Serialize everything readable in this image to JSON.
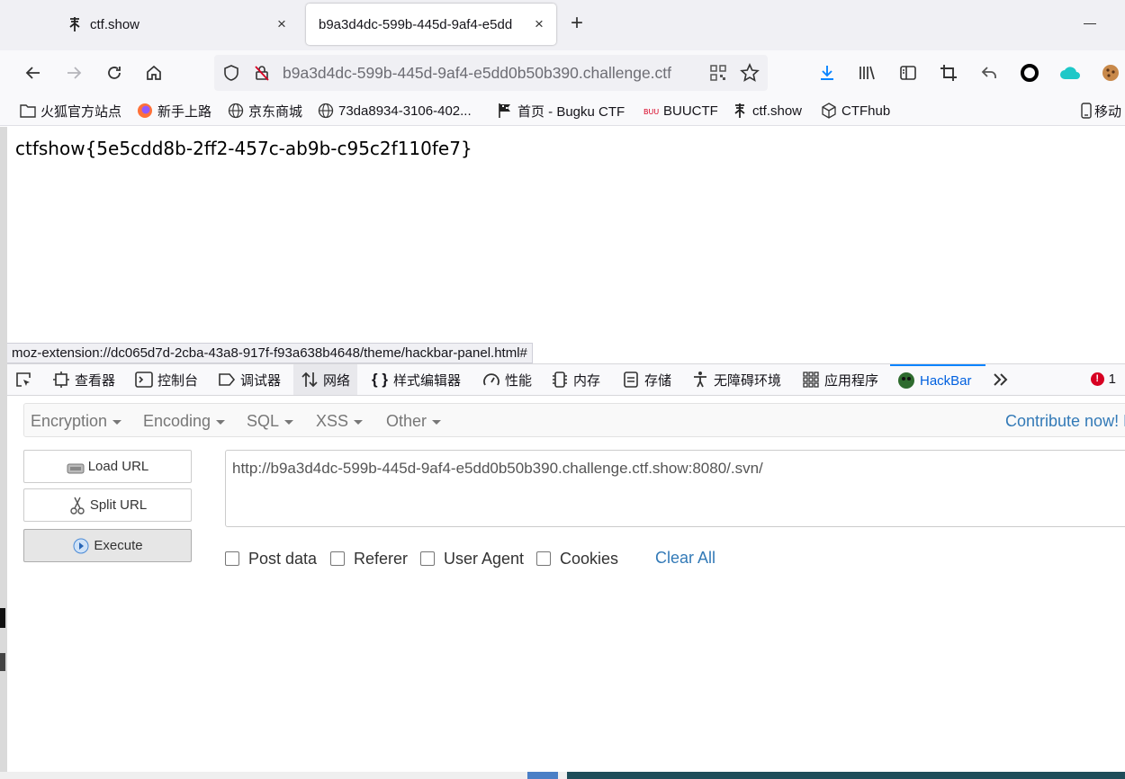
{
  "tabs": [
    {
      "title": "ctf.show",
      "close": "×"
    },
    {
      "title": "b9a3d4dc-599b-445d-9af4-e5dd",
      "close": "×"
    }
  ],
  "new_tab": "+",
  "navbar": {
    "url": "b9a3d4dc-599b-445d-9af4-e5dd0b50b390.challenge.ctf"
  },
  "bookmarks": [
    {
      "label": "火狐官方站点",
      "icon": "folder-icon"
    },
    {
      "label": "新手上路",
      "icon": "firefox-icon"
    },
    {
      "label": "京东商城",
      "icon": "globe-icon"
    },
    {
      "label": "73da8934-3106-402...",
      "icon": "globe-icon"
    },
    {
      "label": "首页 - Bugku CTF",
      "icon": "flag-icon"
    },
    {
      "label": "BUUCTF",
      "icon": "buuctf-icon"
    },
    {
      "label": "ctf.show",
      "icon": "ctfshow-icon"
    },
    {
      "label": "CTFhub",
      "icon": "cube-icon"
    },
    {
      "label": "移动",
      "icon": "mobile-icon"
    }
  ],
  "page": {
    "flag_text": "ctfshow{5e5cdd8b-2ff2-457c-ab9b-c95c2f110fe7}"
  },
  "status_url": "moz-extension://dc065d7d-2cba-43a8-917f-f93a638b4648/theme/hackbar-panel.html#",
  "devtools": {
    "tabs": [
      "查看器",
      "控制台",
      "调试器",
      "网络",
      "样式编辑器",
      "性能",
      "内存",
      "存储",
      "无障碍环境",
      "应用程序",
      "HackBar"
    ],
    "error_count": "1",
    "error_badge": "!"
  },
  "hackbar": {
    "menu": [
      "Encryption",
      "Encoding",
      "SQL",
      "XSS",
      "Other"
    ],
    "contribute": "Contribute now! H",
    "buttons": {
      "load": "Load URL",
      "split": "Split URL",
      "execute": "Execute"
    },
    "url_value": "http://b9a3d4dc-599b-445d-9af4-e5dd0b50b390.challenge.ctf.show:8080/.svn/",
    "options": [
      "Post data",
      "Referer",
      "User Agent",
      "Cookies"
    ],
    "clear_all": "Clear All"
  },
  "colors": {
    "accent": "#0060df",
    "link": "#337ab7",
    "error": "#d70022"
  }
}
